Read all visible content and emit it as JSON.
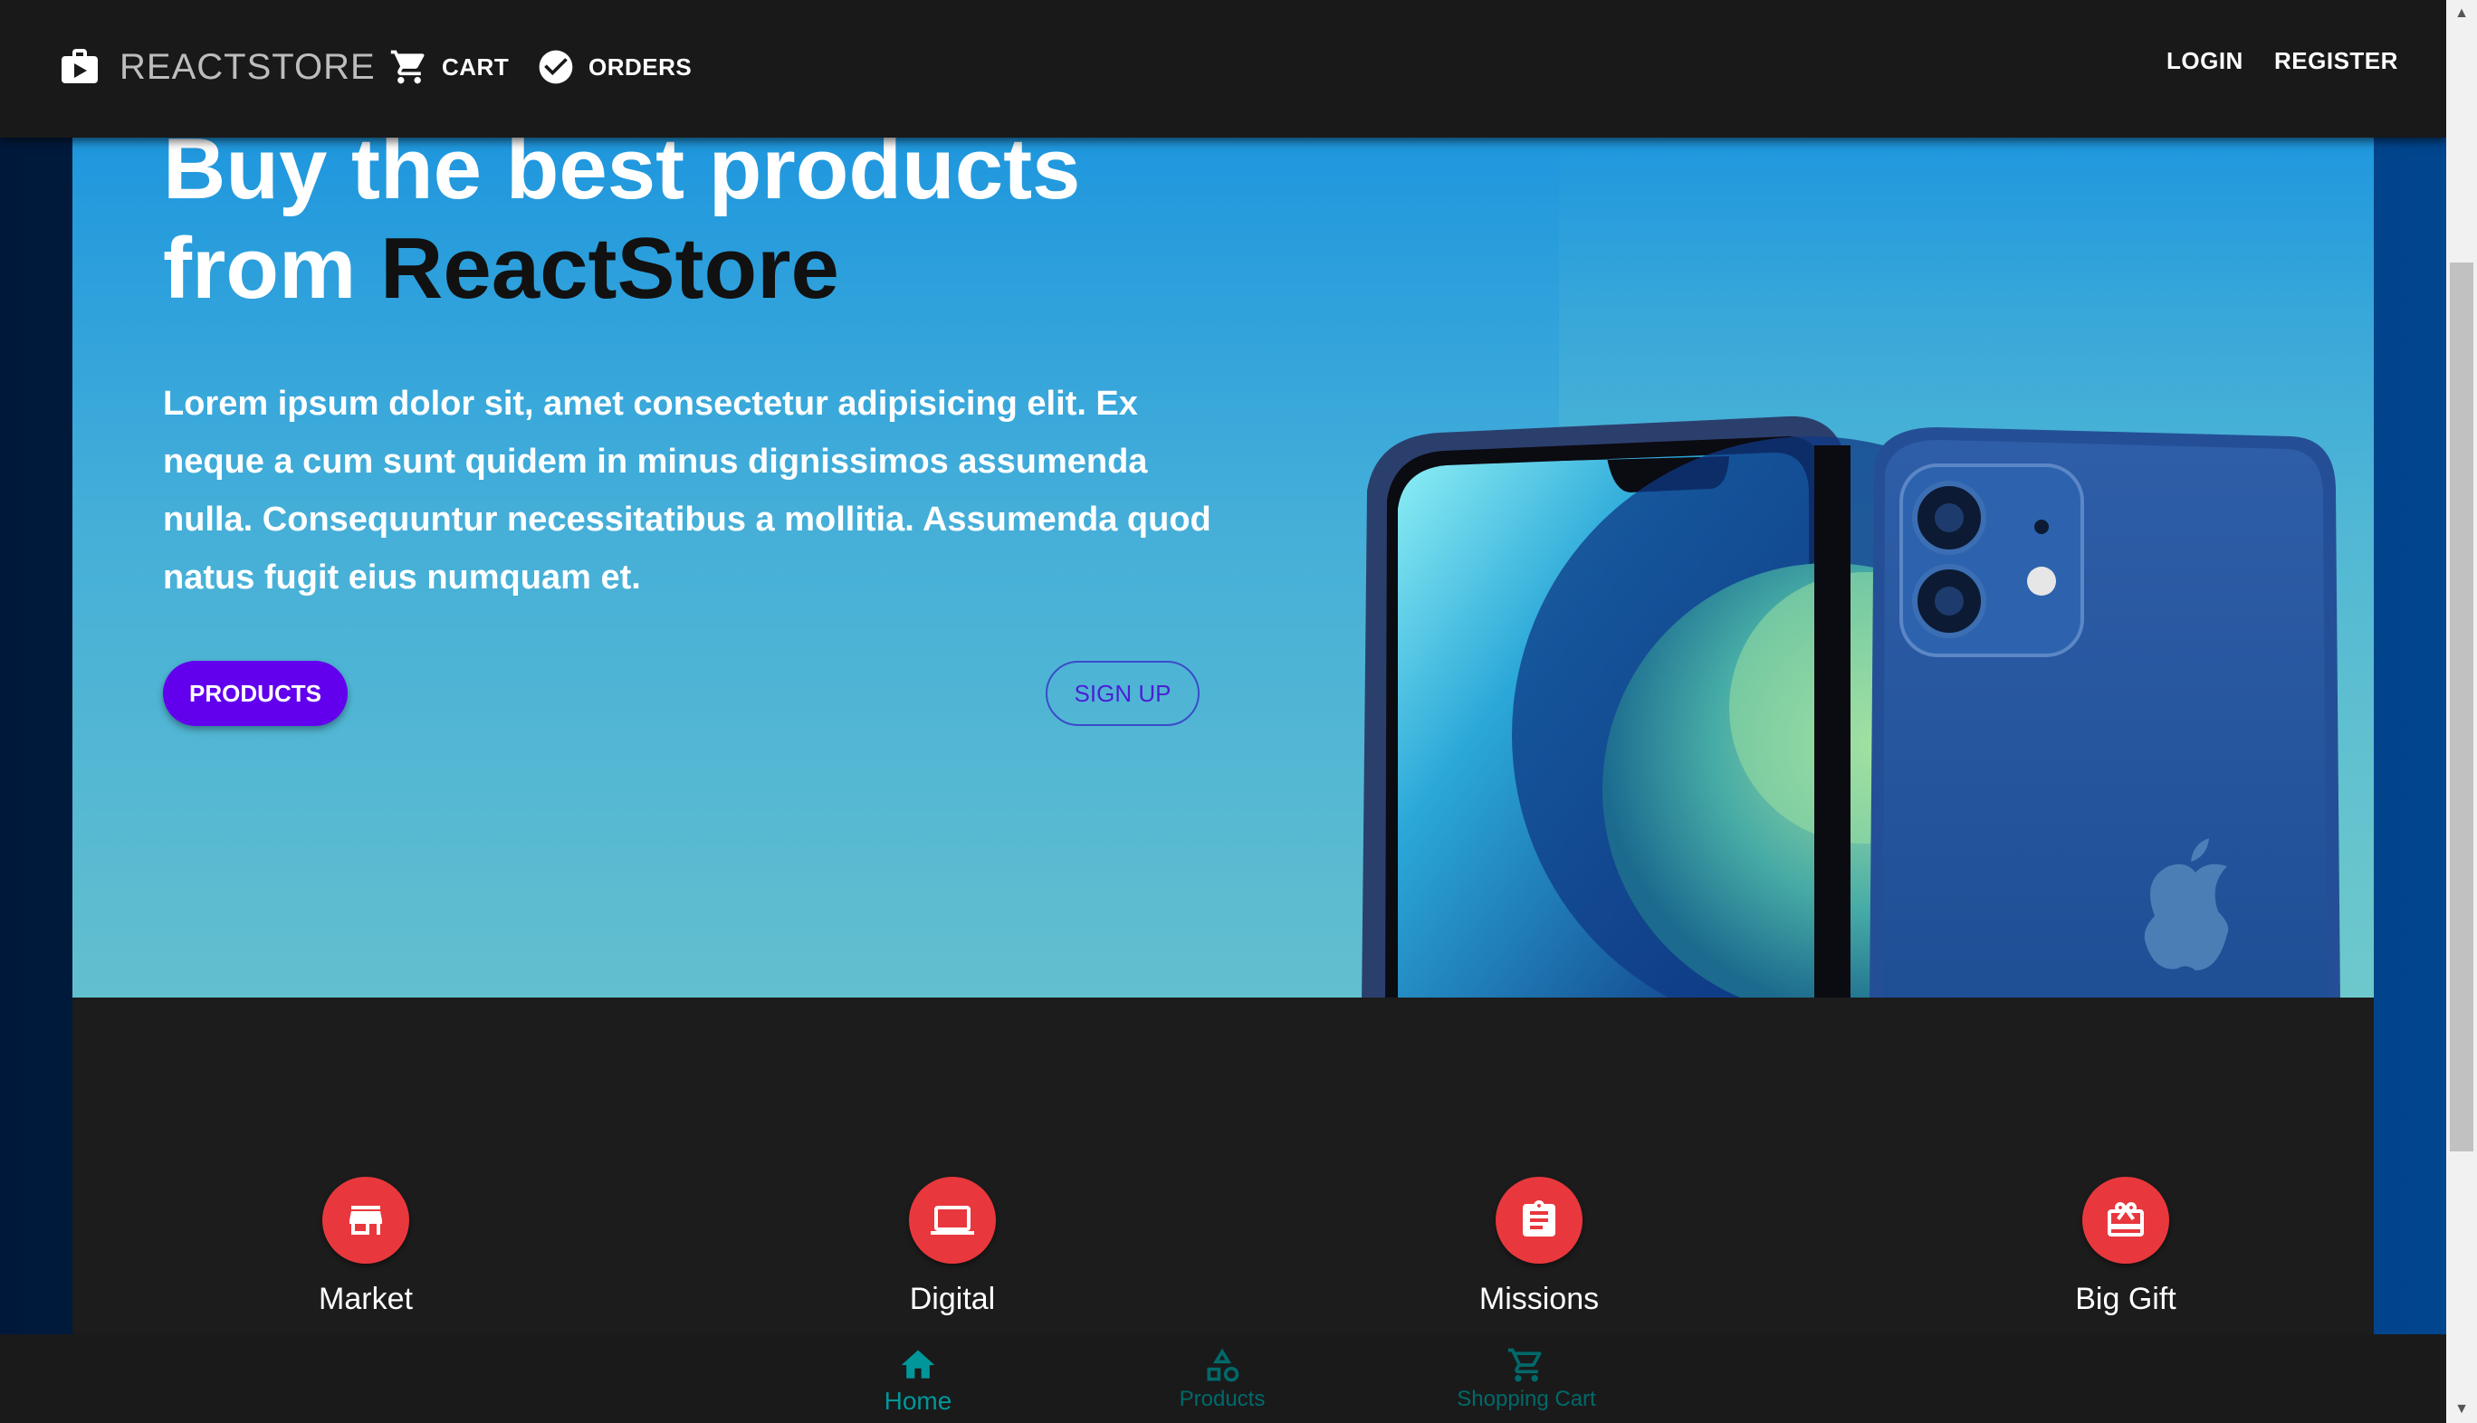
{
  "appbar": {
    "brand": "REACTSTORE",
    "cart": "CART",
    "orders": "ORDERS",
    "login": "LOGIN",
    "register": "REGISTER"
  },
  "hero": {
    "headline_line1": "Buy the best products",
    "headline_prefix": "from ",
    "headline_accent": "ReactStore",
    "blurb": "Lorem ipsum dolor sit, amet consectetur adipisicing elit. Ex neque a cum sunt quidem in minus dignissimos assumenda nulla. Consequuntur necessitatibus a mollitia. Assumenda quod natus fugit eius numquam et.",
    "products_button": "PRODUCTS",
    "signup_button": "SIGN UP"
  },
  "features": [
    {
      "label": "Market",
      "icon": "store-icon"
    },
    {
      "label": "Digital",
      "icon": "laptop-icon"
    },
    {
      "label": "Missions",
      "icon": "clipboard-icon"
    },
    {
      "label": "Big Gift",
      "icon": "gift-card-icon"
    }
  ],
  "bottom_nav": {
    "home": "Home",
    "products": "Products",
    "shopping_cart": "Shopping Cart"
  },
  "colors": {
    "appbar": "#191919",
    "primary_button": "#6200ee",
    "feature_circle": "#e8383d",
    "bottom_nav_active": "#00979a"
  }
}
